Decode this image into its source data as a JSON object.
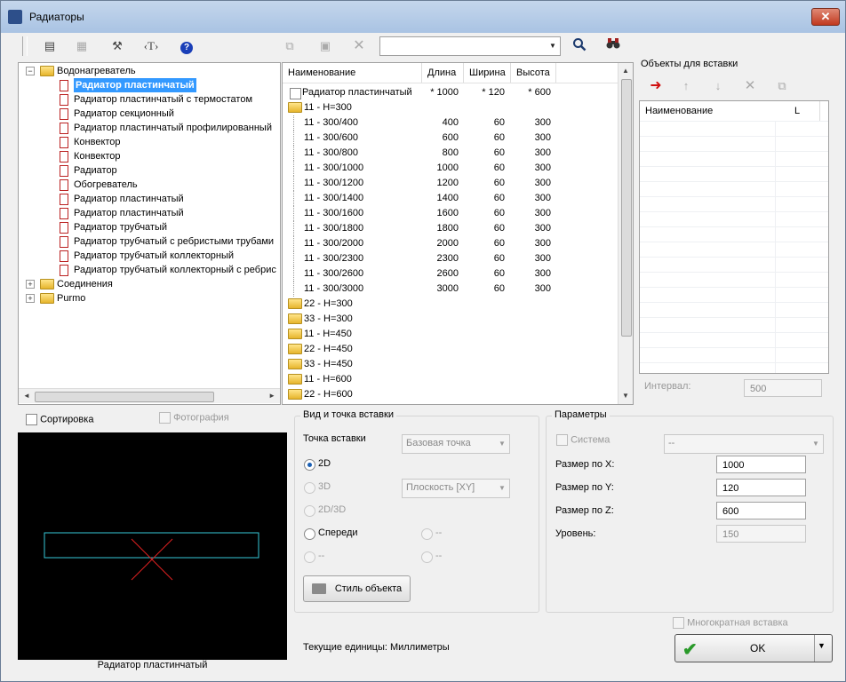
{
  "window": {
    "title": "Радиаторы"
  },
  "toolbar": {
    "search_value": ""
  },
  "tree": {
    "root1": "Водонагреватель",
    "items": [
      "Радиатор пластинчатый",
      "Радиатор пластинчатый с термостатом",
      "Радиатор секционный",
      "Радиатор пластинчатый профилированный",
      "Конвектор",
      "Конвектор",
      "Радиатор",
      "Обогреватель",
      "Радиатор пластинчатый",
      "Радиатор пластинчатый",
      "Радиатор трубчатый",
      "Радиатор трубчатый с ребристыми трубами",
      "Радиатор трубчатый коллекторный",
      "Радиатор трубчатый коллекторный с ребрис"
    ],
    "root2": "Соединения",
    "root3": "Purmo"
  },
  "table": {
    "headers": {
      "name": "Наименование",
      "length": "Длина",
      "width": "Ширина",
      "height": "Высота"
    },
    "first_row": {
      "name": "Радиатор пластинчатый",
      "length": "* 1000",
      "width": "* 120",
      "height": "* 600"
    },
    "group1": "11 - H=300",
    "rows": [
      {
        "name": "11 - 300/400",
        "length": "400",
        "width": "60",
        "height": "300"
      },
      {
        "name": "11 - 300/600",
        "length": "600",
        "width": "60",
        "height": "300"
      },
      {
        "name": "11 - 300/800",
        "length": "800",
        "width": "60",
        "height": "300"
      },
      {
        "name": "11 - 300/1000",
        "length": "1000",
        "width": "60",
        "height": "300"
      },
      {
        "name": "11 - 300/1200",
        "length": "1200",
        "width": "60",
        "height": "300"
      },
      {
        "name": "11 - 300/1400",
        "length": "1400",
        "width": "60",
        "height": "300"
      },
      {
        "name": "11 - 300/1600",
        "length": "1600",
        "width": "60",
        "height": "300"
      },
      {
        "name": "11 - 300/1800",
        "length": "1800",
        "width": "60",
        "height": "300"
      },
      {
        "name": "11 - 300/2000",
        "length": "2000",
        "width": "60",
        "height": "300"
      },
      {
        "name": "11 - 300/2300",
        "length": "2300",
        "width": "60",
        "height": "300"
      },
      {
        "name": "11 - 300/2600",
        "length": "2600",
        "width": "60",
        "height": "300"
      },
      {
        "name": "11 - 300/3000",
        "length": "3000",
        "width": "60",
        "height": "300"
      }
    ],
    "groups": [
      "22 - H=300",
      "33 - H=300",
      "11 - H=450",
      "22 - H=450",
      "33 - H=450",
      "11 - H=600",
      "22 - H=600"
    ]
  },
  "objects": {
    "title": "Объекты для вставки",
    "col_name": "Наименование",
    "col_l": "L",
    "interval_label": "Интервал:",
    "interval_value": "500"
  },
  "options": {
    "sort_label": "Сортировка",
    "photo_label": "Фотография",
    "preview_caption": "Радиатор пластинчатый"
  },
  "view": {
    "title": "Вид и точка вставки",
    "insert_point_label": "Точка вставки",
    "insert_point_value": "Базовая точка",
    "r2d": "2D",
    "r3d": "3D",
    "plane_value": "Плоскость  [XY]",
    "r2d3d": "2D/3D",
    "front": "Спереди",
    "dash1": "--",
    "dash2": "--",
    "dash3": "--",
    "style_button": "Стиль объекта"
  },
  "params": {
    "title": "Параметры",
    "system_label": "Система",
    "system_value": "--",
    "size_x_label": "Размер по X:",
    "size_x": "1000",
    "size_y_label": "Размер по Y:",
    "size_y": "120",
    "size_z_label": "Размер по Z:",
    "size_z": "600",
    "level_label": "Уровень:",
    "level": "150"
  },
  "footer": {
    "multi_insert": "Многократная вставка",
    "units": "Текущие единицы: Миллиметры",
    "ok": "OK"
  }
}
